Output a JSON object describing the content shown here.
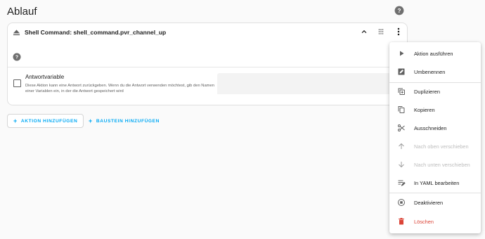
{
  "page": {
    "title": "Ablauf"
  },
  "card": {
    "title": "Shell Command: shell_command.pvr_channel_up",
    "response_label": "Antwortvariable",
    "response_description": "Diese Aktion kann eine Antwort zurückgeben. Wenn du die Antwort verwenden möchtest, gib den Namen einer Variablen ein, in der die Antwort gespeichert wird"
  },
  "buttons": {
    "add_action": "AKTION HINZUFÜGEN",
    "add_block": "BAUSTEIN HINZUFÜGEN"
  },
  "menu": {
    "items": [
      {
        "label": "Aktion ausführen",
        "icon": "play-icon"
      },
      {
        "label": "Umbenennen",
        "icon": "rename-icon"
      },
      {
        "label": "Duplizieren",
        "icon": "duplicate-icon"
      },
      {
        "label": "Kopieren",
        "icon": "copy-icon"
      },
      {
        "label": "Ausschneiden",
        "icon": "scissors-icon"
      },
      {
        "label": "Nach oben verschieben",
        "icon": "arrow-up-icon",
        "disabled": true
      },
      {
        "label": "Nach unten verschieben",
        "icon": "arrow-down-icon",
        "disabled": true
      },
      {
        "label": "In YAML bearbeiten",
        "icon": "yaml-edit-icon"
      },
      {
        "label": "Deaktivieren",
        "icon": "disable-icon"
      },
      {
        "label": "Löschen",
        "icon": "trash-icon",
        "danger": true
      }
    ]
  },
  "colors": {
    "accent": "#03a9f4",
    "danger": "#db4437",
    "disabled": "#bdbdbd"
  }
}
